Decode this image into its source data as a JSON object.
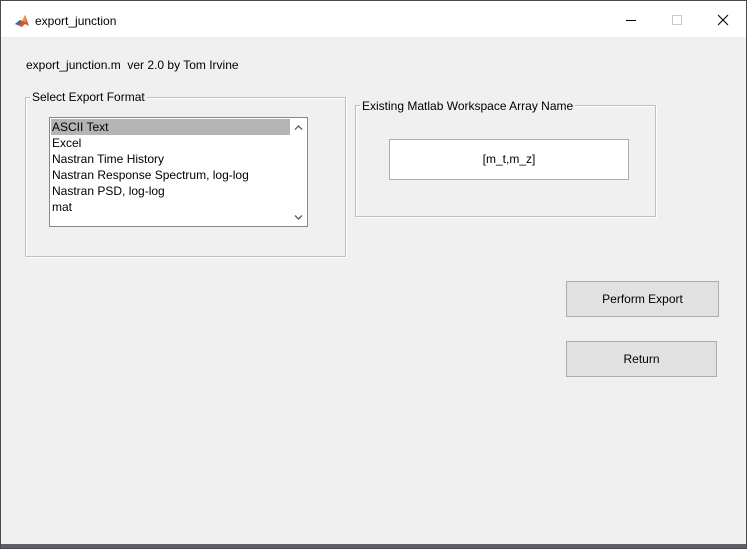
{
  "window": {
    "title": "export_junction",
    "icon": "matlab-icon"
  },
  "header": {
    "text": "export_junction.m  ver 2.0 by Tom Irvine"
  },
  "format_group": {
    "title": "Select Export Format",
    "selected_index": 0,
    "items": [
      "ASCII Text",
      "Excel",
      "Nastran Time History",
      "Nastran Response Spectrum, log-log",
      "Nastran PSD, log-log",
      "mat"
    ]
  },
  "array_group": {
    "title": "Existing Matlab Workspace Array Name",
    "value": "[m_t,m_z]"
  },
  "buttons": {
    "export_label": "Perform Export",
    "return_label": "Return"
  },
  "colors": {
    "selection": "#b4b4b4",
    "background": "#f0f0f0",
    "button": "#e1e1e1"
  }
}
